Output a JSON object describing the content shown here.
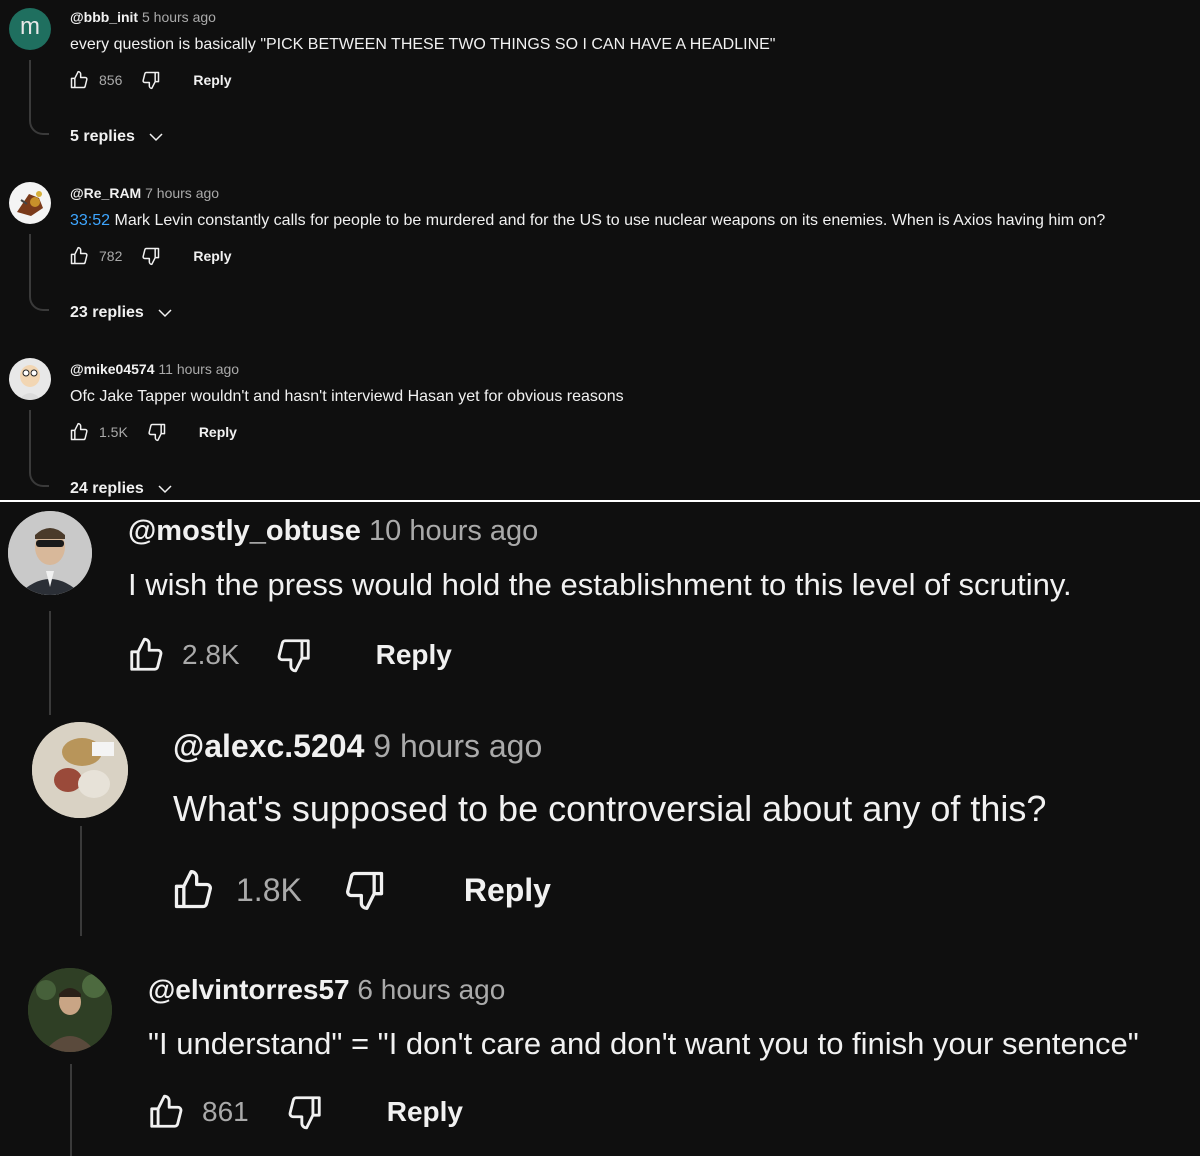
{
  "comments": [
    {
      "handle": "@bbb_init",
      "time": "5 hours ago",
      "text": "every question is basically \"PICK BETWEEN THESE TWO THINGS SO I CAN HAVE A HEADLINE\"",
      "likes": "856",
      "reply_label": "Reply",
      "replies_label": "5 replies",
      "avatar_letter": "m",
      "avatar_color": "#1f6f5f"
    },
    {
      "handle": "@Re_RAM",
      "time": "7 hours ago",
      "timestamp": "33:52",
      "text": " Mark Levin constantly calls for people to be murdered and for the US to use nuclear weapons on its enemies. When is Axios having him on?",
      "likes": "782",
      "reply_label": "Reply",
      "replies_label": "23 replies"
    },
    {
      "handle": "@mike04574",
      "time": "11 hours ago",
      "text": "Ofc Jake Tapper wouldn't and hasn't interviewd Hasan yet for obvious reasons",
      "likes": "1.5K",
      "reply_label": "Reply",
      "replies_label": "24 replies"
    },
    {
      "handle": "@mostly_obtuse",
      "time": "10 hours ago",
      "text": "I wish the press would hold the establishment to this level of scrutiny.",
      "likes": "2.8K",
      "reply_label": "Reply"
    },
    {
      "handle": "@alexc.5204",
      "time": "9 hours ago",
      "text": "What's supposed to be controversial about any of this?",
      "likes": "1.8K",
      "reply_label": "Reply"
    },
    {
      "handle": "@elvintorres57",
      "time": "6 hours ago",
      "text": "\"I understand\" = \"I don't care and don't want you to finish your sentence\"",
      "likes": "861",
      "reply_label": "Reply"
    }
  ],
  "colors": {
    "background": "#0f0f0f",
    "text": "#f1f1f1",
    "secondary": "#aaaaaa",
    "timestamp_link": "#3ea6ff"
  },
  "icons": [
    "thumbs-up-icon",
    "thumbs-down-icon",
    "chevron-down-icon"
  ]
}
